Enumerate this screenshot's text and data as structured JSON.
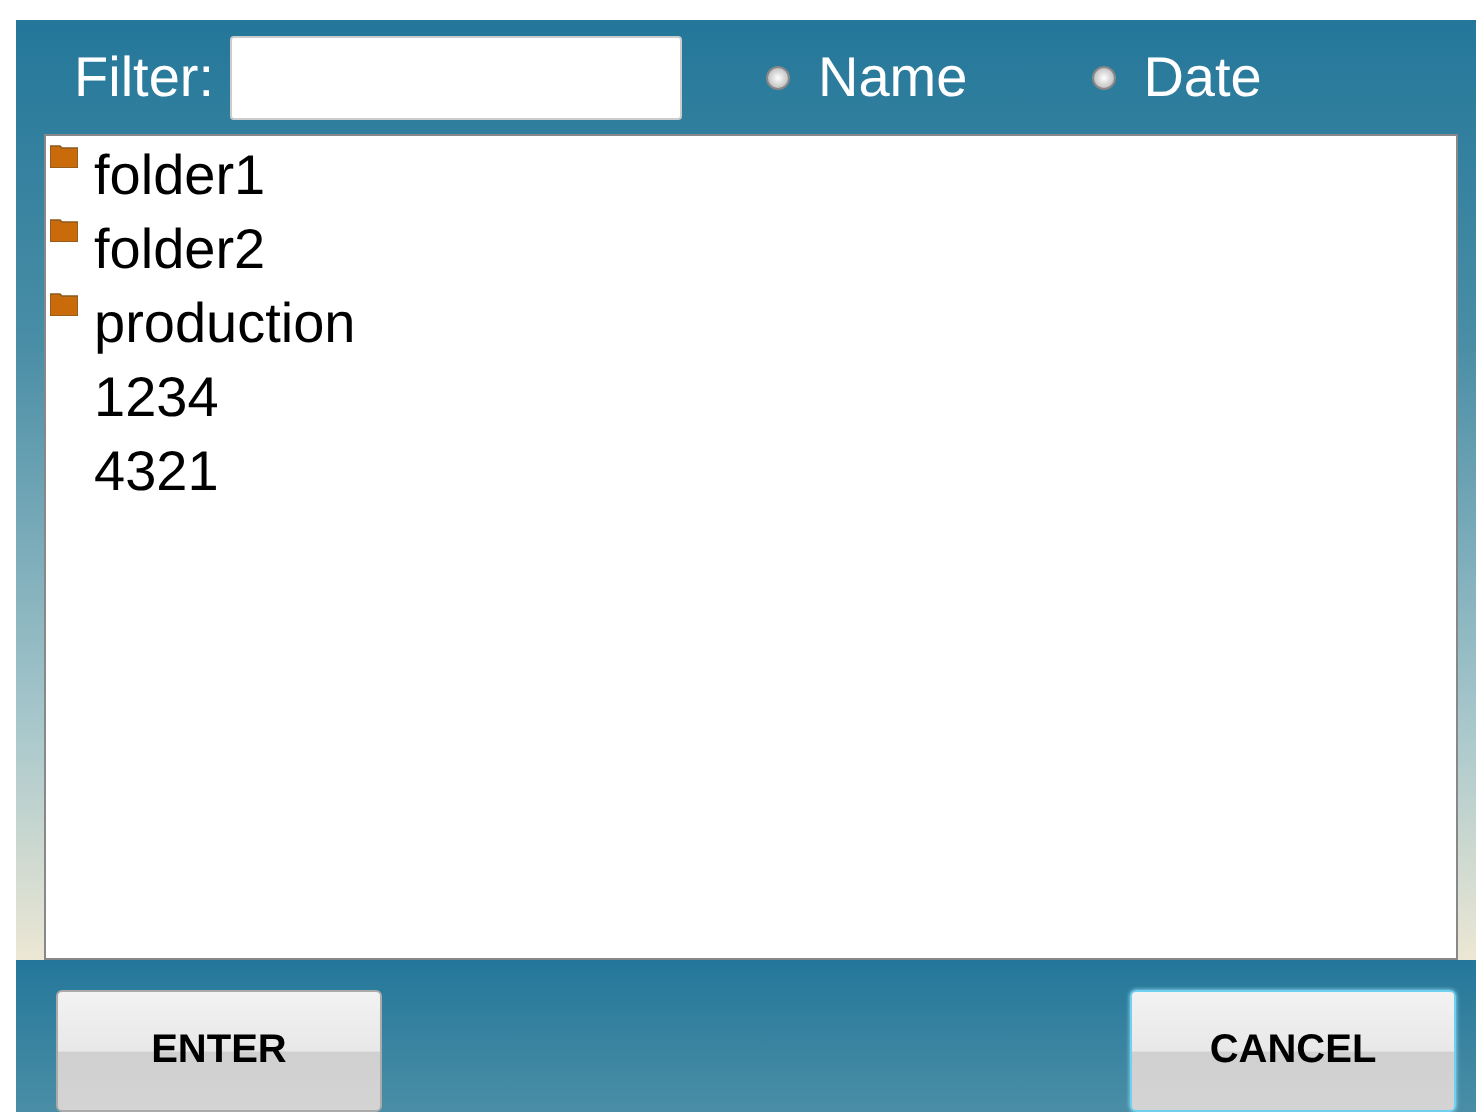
{
  "filter": {
    "label": "Filter:"
  },
  "sort_options": [
    {
      "label": "Name",
      "selected": false
    },
    {
      "label": "Date",
      "selected": false
    }
  ],
  "items": [
    {
      "kind": "folder",
      "label": "folder1"
    },
    {
      "kind": "folder",
      "label": "folder2"
    },
    {
      "kind": "folder",
      "label": "production"
    },
    {
      "kind": "file",
      "label": "1234"
    },
    {
      "kind": "file",
      "label": "4321"
    }
  ],
  "buttons": [
    {
      "label": "ENTER",
      "focused": false
    },
    {
      "label": "CANCEL",
      "focused": true
    }
  ]
}
